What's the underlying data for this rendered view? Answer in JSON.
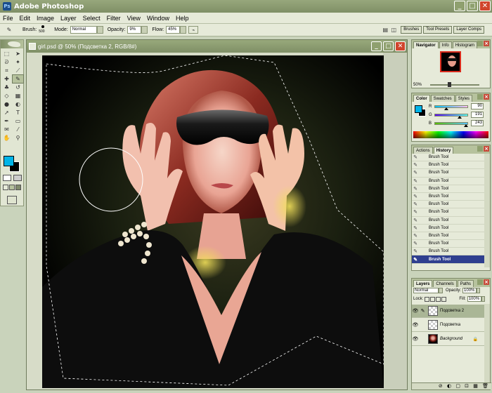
{
  "app": {
    "title": "Adobe Photoshop",
    "logo": "Ps"
  },
  "window_controls": {
    "minimize": "_",
    "maximize": "□",
    "close": "✕"
  },
  "menu": [
    "File",
    "Edit",
    "Image",
    "Layer",
    "Select",
    "Filter",
    "View",
    "Window",
    "Help"
  ],
  "options_bar": {
    "brush_label": "Brush:",
    "brush_size": "500",
    "mode_label": "Mode:",
    "mode_value": "Normal",
    "opacity_label": "Opacity:",
    "opacity_value": "9%",
    "flow_label": "Flow:",
    "flow_value": "45%",
    "well_tabs": [
      "Brushes",
      "Tool Presets",
      "Layer Comps"
    ]
  },
  "toolbox": {
    "tools": [
      "marquee-tool",
      "move-tool",
      "lasso-tool",
      "magic-wand-tool",
      "crop-tool",
      "slice-tool",
      "healing-brush-tool",
      "brush-tool",
      "clone-stamp-tool",
      "history-brush-tool",
      "eraser-tool",
      "gradient-tool",
      "blur-tool",
      "dodge-tool",
      "path-selection-tool",
      "type-tool",
      "pen-tool",
      "shape-tool",
      "notes-tool",
      "eyedropper-tool",
      "hand-tool",
      "zoom-tool"
    ],
    "glyphs": [
      "⬚",
      "➤",
      "ᘐ",
      "✦",
      "⌗",
      "⟋",
      "✚",
      "✎",
      "♣",
      "↺",
      "◇",
      "▦",
      "●",
      "◐",
      "➚",
      "T",
      "✒",
      "▭",
      "✉",
      "⁄",
      "✋",
      "⚲"
    ],
    "active_tool": "brush-tool",
    "foreground_color": "#00b4e8",
    "background_color": "#000000"
  },
  "document": {
    "title": "girl.psd @ 50% (Подсветка 2, RGB/8#)"
  },
  "navigator": {
    "tabs": [
      "Navigator",
      "Info",
      "Histogram"
    ],
    "active_tab": "Navigator",
    "zoom": "50%",
    "zoom_level": 0.35
  },
  "color": {
    "tabs": [
      "Color",
      "Swatches",
      "Styles"
    ],
    "active_tab": "Color",
    "channels": [
      {
        "label": "R",
        "value": "90",
        "fraction": 0.35
      },
      {
        "label": "G",
        "value": "191",
        "fraction": 0.75
      },
      {
        "label": "B",
        "value": "243",
        "fraction": 0.95
      }
    ],
    "foreground": "#00b4e8",
    "background": "#000000"
  },
  "history": {
    "tabs": [
      "Actions",
      "History"
    ],
    "active_tab": "History",
    "items": [
      "Brush Tool",
      "Brush Tool",
      "Brush Tool",
      "Brush Tool",
      "Brush Tool",
      "Brush Tool",
      "Brush Tool",
      "Brush Tool",
      "Brush Tool",
      "Brush Tool",
      "Brush Tool",
      "Brush Tool",
      "Brush Tool",
      "Brush Tool"
    ],
    "current": "Brush Tool"
  },
  "layers": {
    "tabs": [
      "Layers",
      "Channels",
      "Paths"
    ],
    "active_tab": "Layers",
    "blend_mode": "Normal",
    "opacity_label": "Opacity:",
    "opacity_value": "100%",
    "lock_label": "Lock:",
    "fill_label": "Fill:",
    "fill_value": "100%",
    "items": [
      {
        "name": "Подсветка 2",
        "selected": true,
        "thumb": "transparent"
      },
      {
        "name": "Подсветка",
        "selected": false,
        "thumb": "transparent"
      },
      {
        "name": "Background",
        "selected": false,
        "thumb": "photo",
        "locked": true
      }
    ],
    "bottom_icons": "⊘ ◐ ▢ ⊡ ▦ 🗑"
  }
}
